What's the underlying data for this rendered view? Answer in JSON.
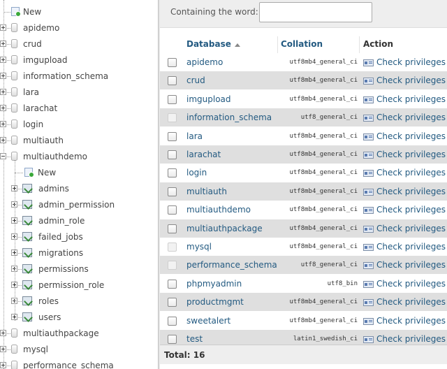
{
  "nav": {
    "items": [
      {
        "label": "New",
        "kind": "new",
        "level": 0
      },
      {
        "label": "apidemo",
        "kind": "db",
        "level": 0
      },
      {
        "label": "crud",
        "kind": "db",
        "level": 0
      },
      {
        "label": "imgupload",
        "kind": "db",
        "level": 0
      },
      {
        "label": "information_schema",
        "kind": "db",
        "level": 0
      },
      {
        "label": "lara",
        "kind": "db",
        "level": 0
      },
      {
        "label": "larachat",
        "kind": "db",
        "level": 0
      },
      {
        "label": "login",
        "kind": "db",
        "level": 0
      },
      {
        "label": "multiauth",
        "kind": "db",
        "level": 0
      },
      {
        "label": "multiauthdemo",
        "kind": "db-open",
        "level": 0
      },
      {
        "label": "New",
        "kind": "new",
        "level": 1
      },
      {
        "label": "admins",
        "kind": "table",
        "level": 1
      },
      {
        "label": "admin_permission",
        "kind": "table",
        "level": 1
      },
      {
        "label": "admin_role",
        "kind": "table",
        "level": 1
      },
      {
        "label": "failed_jobs",
        "kind": "table",
        "level": 1
      },
      {
        "label": "migrations",
        "kind": "table",
        "level": 1
      },
      {
        "label": "permissions",
        "kind": "table",
        "level": 1
      },
      {
        "label": "permission_role",
        "kind": "table",
        "level": 1
      },
      {
        "label": "roles",
        "kind": "table",
        "level": 1
      },
      {
        "label": "users",
        "kind": "table",
        "level": 1
      },
      {
        "label": "multiauthpackage",
        "kind": "db",
        "level": 0
      },
      {
        "label": "mysql",
        "kind": "db",
        "level": 0
      },
      {
        "label": "performance_schema",
        "kind": "db",
        "level": 0
      }
    ]
  },
  "filter": {
    "label": "Containing the word:",
    "value": ""
  },
  "table": {
    "headers": {
      "database": "Database",
      "collation": "Collation",
      "action": "Action"
    },
    "sort_icon": "sort-ascending-icon",
    "rows": [
      {
        "name": "apidemo",
        "collation": "utf8mb4_general_ci",
        "action": "Check privileges",
        "selectable": true
      },
      {
        "name": "crud",
        "collation": "utf8mb4_general_ci",
        "action": "Check privileges",
        "selectable": true
      },
      {
        "name": "imgupload",
        "collation": "utf8mb4_general_ci",
        "action": "Check privileges",
        "selectable": true
      },
      {
        "name": "information_schema",
        "collation": "utf8_general_ci",
        "action": "Check privileges",
        "selectable": false
      },
      {
        "name": "lara",
        "collation": "utf8mb4_general_ci",
        "action": "Check privileges",
        "selectable": true
      },
      {
        "name": "larachat",
        "collation": "utf8mb4_general_ci",
        "action": "Check privileges",
        "selectable": true
      },
      {
        "name": "login",
        "collation": "utf8mb4_general_ci",
        "action": "Check privileges",
        "selectable": true
      },
      {
        "name": "multiauth",
        "collation": "utf8mb4_general_ci",
        "action": "Check privileges",
        "selectable": true
      },
      {
        "name": "multiauthdemo",
        "collation": "utf8mb4_general_ci",
        "action": "Check privileges",
        "selectable": true
      },
      {
        "name": "multiauthpackage",
        "collation": "utf8mb4_general_ci",
        "action": "Check privileges",
        "selectable": true
      },
      {
        "name": "mysql",
        "collation": "utf8mb4_general_ci",
        "action": "Check privileges",
        "selectable": false
      },
      {
        "name": "performance_schema",
        "collation": "utf8_general_ci",
        "action": "Check privileges",
        "selectable": false
      },
      {
        "name": "phpmyadmin",
        "collation": "utf8_bin",
        "action": "Check privileges",
        "selectable": true
      },
      {
        "name": "productmgmt",
        "collation": "utf8mb4_general_ci",
        "action": "Check privileges",
        "selectable": true
      },
      {
        "name": "sweetalert",
        "collation": "utf8mb4_general_ci",
        "action": "Check privileges",
        "selectable": true
      },
      {
        "name": "test",
        "collation": "latin1_swedish_ci",
        "action": "Check privileges",
        "selectable": true
      }
    ],
    "total": "Total: 16"
  },
  "colors": {
    "link": "#235a81",
    "row_alt": "#dfdfdf"
  }
}
